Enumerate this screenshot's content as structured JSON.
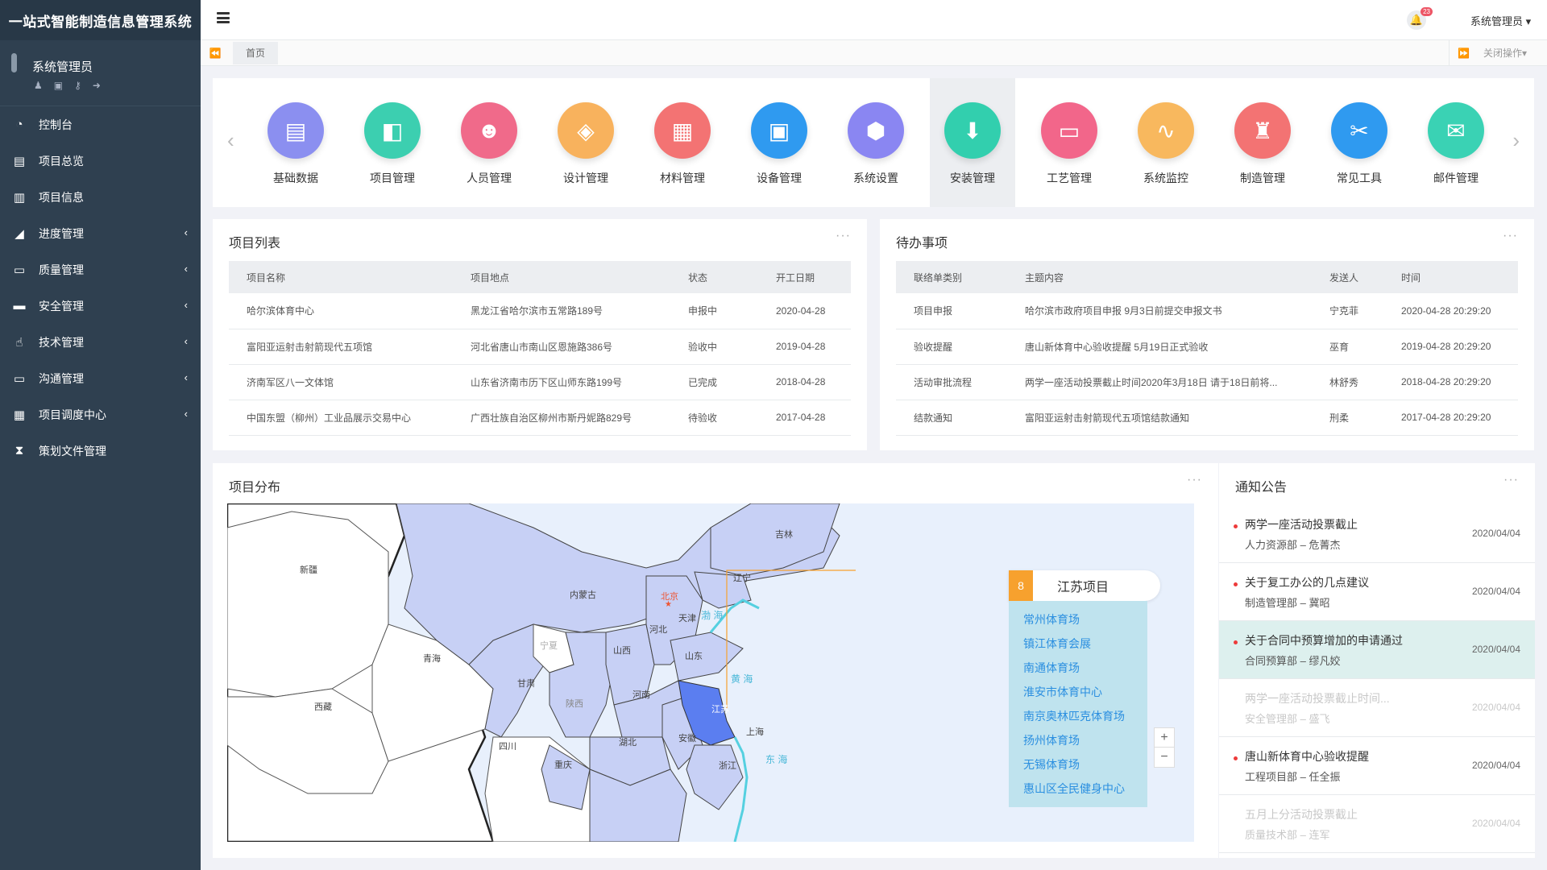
{
  "app_title": "一站式智能制造信息管理系统",
  "profile": {
    "name": "系统管理员",
    "icons": [
      "user-icon",
      "idcard-icon",
      "key-icon",
      "logout-icon"
    ]
  },
  "sidebar": {
    "items": [
      {
        "label": "控制台",
        "icon": "dashboard-icon",
        "arrow": ""
      },
      {
        "label": "项目总览",
        "icon": "file-icon",
        "arrow": ""
      },
      {
        "label": "项目信息",
        "icon": "file-text-icon",
        "arrow": ""
      },
      {
        "label": "进度管理",
        "icon": "area-chart-icon",
        "arrow": "‹"
      },
      {
        "label": "质量管理",
        "icon": "battery-icon",
        "arrow": "‹"
      },
      {
        "label": "安全管理",
        "icon": "monitor-icon",
        "arrow": "‹"
      },
      {
        "label": "技术管理",
        "icon": "hand-icon",
        "arrow": "‹"
      },
      {
        "label": "沟通管理",
        "icon": "battery-icon",
        "arrow": "‹"
      },
      {
        "label": "项目调度中心",
        "icon": "calendar-icon",
        "arrow": "‹"
      },
      {
        "label": "策划文件管理",
        "icon": "hourglass-icon",
        "arrow": ""
      }
    ]
  },
  "topbar": {
    "notification_count": "23",
    "user_label": "系统管理员 ▾"
  },
  "tabs": {
    "home": "首页",
    "close_ops": "关闭操作▾"
  },
  "apps": [
    {
      "label": "基础数据",
      "color": "#8b8ff0",
      "glyph": "▤"
    },
    {
      "label": "项目管理",
      "color": "#3ccfb0",
      "glyph": "◧"
    },
    {
      "label": "人员管理",
      "color": "#f06a8a",
      "glyph": "☻"
    },
    {
      "label": "设计管理",
      "color": "#f8b25d",
      "glyph": "◈"
    },
    {
      "label": "材料管理",
      "color": "#f37373",
      "glyph": "▦"
    },
    {
      "label": "设备管理",
      "color": "#2f9af0",
      "glyph": "▣"
    },
    {
      "label": "系统设置",
      "color": "#8a86f2",
      "glyph": "⬢"
    },
    {
      "label": "安装管理",
      "color": "#32cfae",
      "glyph": "⬇"
    },
    {
      "label": "工艺管理",
      "color": "#f2668a",
      "glyph": "▭"
    },
    {
      "label": "系统监控",
      "color": "#f8b85e",
      "glyph": "∿"
    },
    {
      "label": "制造管理",
      "color": "#f37373",
      "glyph": "♜"
    },
    {
      "label": "常见工具",
      "color": "#2f9af0",
      "glyph": "✂"
    },
    {
      "label": "邮件管理",
      "color": "#3ad2b4",
      "glyph": "✉"
    }
  ],
  "project_list": {
    "title": "项目列表",
    "headers": [
      "项目名称",
      "项目地点",
      "状态",
      "开工日期"
    ],
    "rows": [
      [
        "哈尔滨体育中心",
        "黑龙江省哈尔滨市五常路189号",
        "申报中",
        "2020-04-28"
      ],
      [
        "富阳亚运射击射箭现代五项馆",
        "河北省唐山市南山区恩施路386号",
        "验收中",
        "2019-04-28"
      ],
      [
        "济南军区八一文体馆",
        "山东省济南市历下区山师东路199号",
        "已完成",
        "2018-04-28"
      ],
      [
        "中国东盟（柳州）工业品展示交易中心",
        "广西壮族自治区柳州市斯丹妮路829号",
        "待验收",
        "2017-04-28"
      ]
    ]
  },
  "todo": {
    "title": "待办事项",
    "headers": [
      "联络单类别",
      "主题内容",
      "发送人",
      "时间"
    ],
    "rows": [
      [
        "项目申报",
        "哈尔滨市政府项目申报 9月3日前提交申报文书",
        "宁克菲",
        "2020-04-28 20:29:20"
      ],
      [
        "验收提醒",
        "唐山新体育中心验收提醒 5月19日正式验收",
        "巫育",
        "2019-04-28 20:29:20"
      ],
      [
        "活动审批流程",
        "两学一座活动投票截止时间2020年3月18日 请于18日前将...",
        "林舒秀",
        "2018-04-28 20:29:20"
      ],
      [
        "结款通知",
        "富阳亚运射击射箭现代五项馆结款通知",
        "刑柔",
        "2017-04-28 20:29:20"
      ]
    ]
  },
  "distribution": {
    "title": "项目分布",
    "provinces": [
      "新疆",
      "西藏",
      "青海",
      "甘肃",
      "宁夏",
      "内蒙古",
      "陕西",
      "四川",
      "重庆",
      "山西",
      "河北",
      "北京",
      "天津",
      "辽宁",
      "吉林",
      "山东",
      "河南",
      "湖北",
      "安徽",
      "江苏",
      "上海",
      "浙江"
    ],
    "seas": [
      "渤 海",
      "黄 海",
      "东 海"
    ],
    "popup": {
      "count": "8",
      "title": "江苏项目",
      "items": [
        "常州体育场",
        "镇江体育会展",
        "南通体育场",
        "淮安市体育中心",
        "南京奥林匹克体育场",
        "扬州体育场",
        "无锡体育场",
        "惠山区全民健身中心"
      ]
    },
    "zoom_in": "+",
    "zoom_out": "−"
  },
  "notices": {
    "title": "通知公告",
    "items": [
      {
        "title": "两学一座活动投票截止",
        "sub": "人力资源部 – 危菁杰",
        "date": "2020/04/04"
      },
      {
        "title": "关于复工办公的几点建议",
        "sub": "制造管理部 – 冀昭",
        "date": "2020/04/04"
      },
      {
        "title": "关于合同中预算增加的申请通过",
        "sub": "合同预算部 – 缪凡姣",
        "date": "2020/04/04"
      },
      {
        "title": "两学一座活动投票截止时间...",
        "sub": "安全管理部 – 盛飞",
        "date": "2020/04/04"
      },
      {
        "title": "唐山新体育中心验收提醒",
        "sub": "工程项目部 – 任全振",
        "date": "2020/04/04"
      },
      {
        "title": "五月上分活动投票截止",
        "sub": "质量技术部 – 连军",
        "date": "2020/04/04"
      }
    ]
  },
  "more_label": "···"
}
